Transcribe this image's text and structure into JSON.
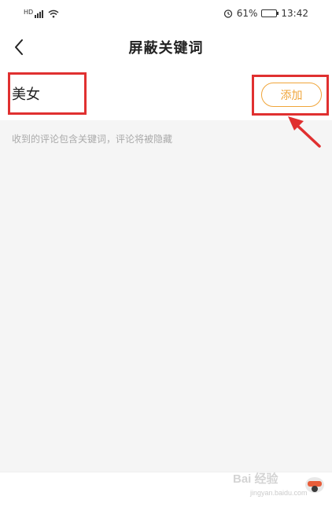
{
  "status_bar": {
    "hd_label": "HD",
    "battery_percent": "61%",
    "time": "13:42",
    "battery_level": 0.61
  },
  "nav": {
    "title": "屏蔽关键词"
  },
  "keyword_input": {
    "value": "美女"
  },
  "add_button": {
    "label": "添加"
  },
  "hint": {
    "text": "收到的评论包含关键词，评论将被隐藏"
  },
  "watermark": {
    "brand": "Bai 经验",
    "url": "jingyan.baidu.com"
  },
  "colors": {
    "accent": "#f0a53a",
    "highlight": "#e03030"
  },
  "icons": [
    "signal-icon",
    "wifi-icon",
    "alarm-icon",
    "battery-icon",
    "back-arrow-icon",
    "pointer-arrow-icon"
  ]
}
